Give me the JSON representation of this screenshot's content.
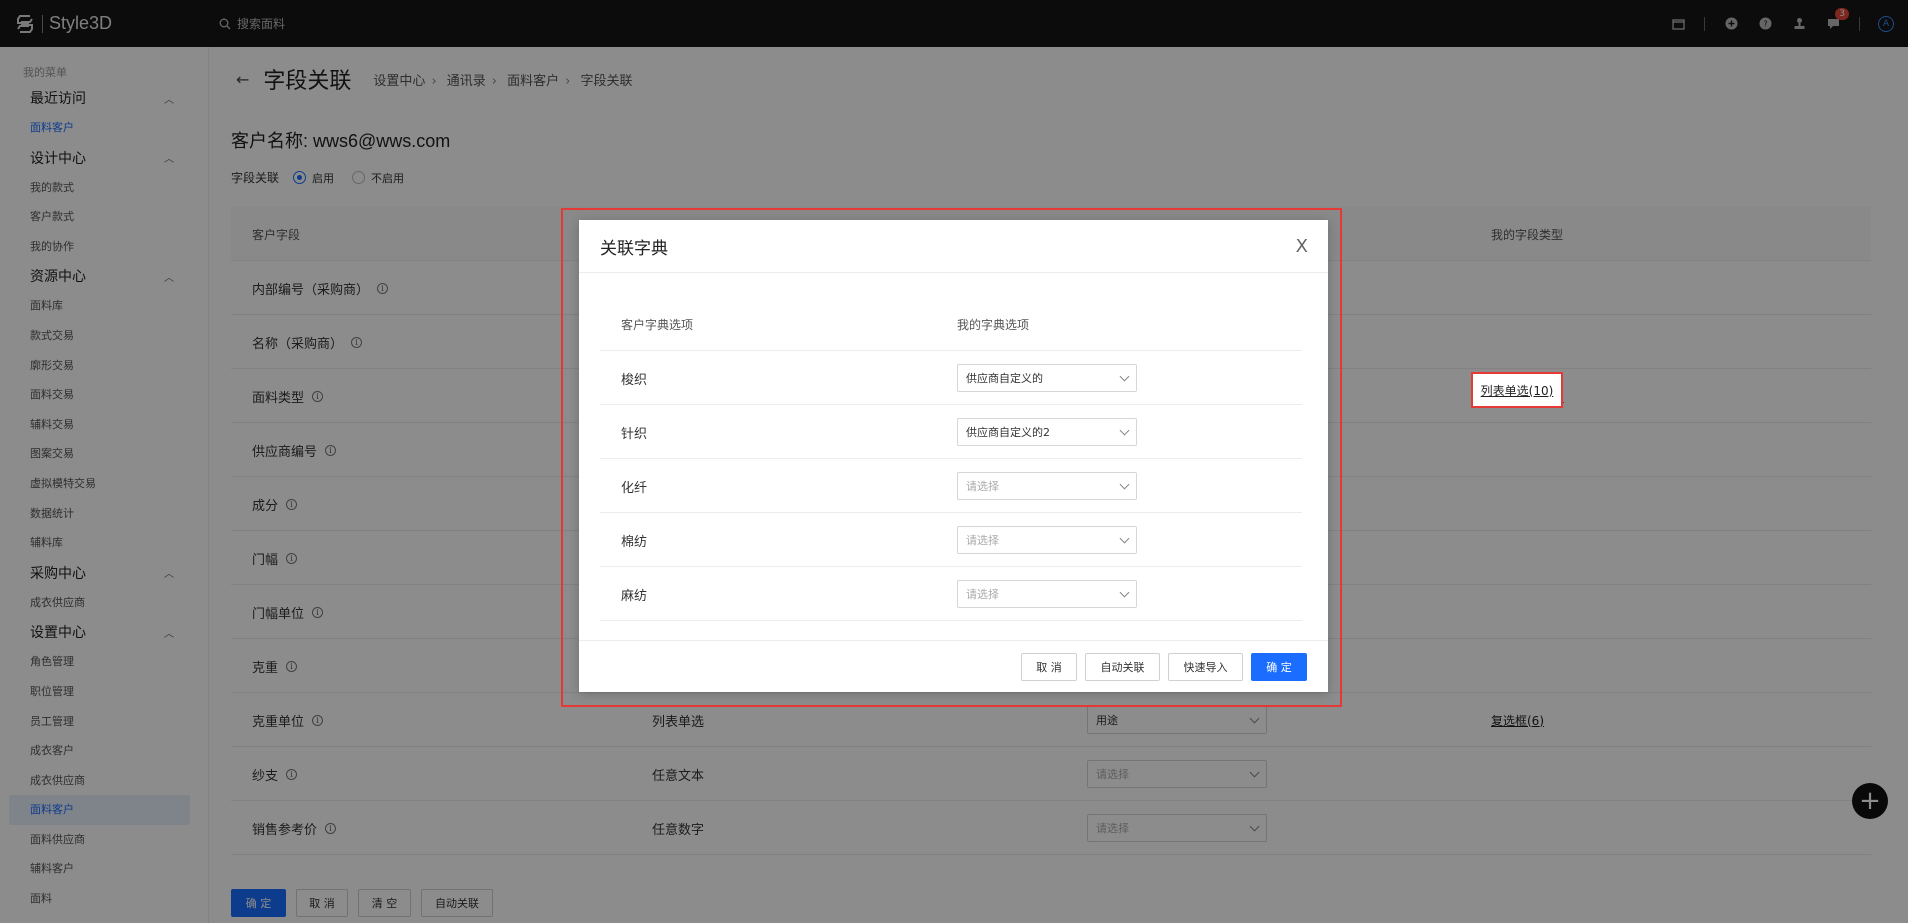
{
  "app": {
    "name": "Style3D",
    "search_placeholder": "搜索面料"
  },
  "topbar": {
    "notification_count": "3",
    "avatar_letter": "A"
  },
  "sidebar": {
    "caption": "我的菜单",
    "groups": [
      {
        "title": "最近访问",
        "items": [
          "面料客户"
        ]
      },
      {
        "title": "设计中心",
        "items": [
          "我的款式",
          "客户款式",
          "我的协作"
        ]
      },
      {
        "title": "资源中心",
        "items": [
          "面料库",
          "款式交易",
          "廓形交易",
          "面料交易",
          "辅料交易",
          "图案交易",
          "虚拟模特交易",
          "数据统计",
          "辅料库"
        ]
      },
      {
        "title": "采购中心",
        "items": [
          "成衣供应商"
        ]
      },
      {
        "title": "设置中心",
        "items": [
          "角色管理",
          "职位管理",
          "员工管理",
          "成衣客户",
          "成衣供应商",
          "面料客户",
          "面料供应商",
          "辅料客户",
          "面料"
        ]
      }
    ]
  },
  "page": {
    "title": "字段关联",
    "breadcrumb": [
      "设置中心",
      "通讯录",
      "面料客户",
      "字段关联"
    ],
    "customer_label": "客户名称: wws6@wws.com",
    "toggle_label": "字段关联",
    "toggle_on": "启用",
    "toggle_off": "不启用",
    "table_headers": [
      "客户字段",
      "我的字段类型"
    ],
    "rows": [
      {
        "field": "内部编号（采购商）",
        "type": "",
        "select": "",
        "my_type": ""
      },
      {
        "field": "名称（采购商）",
        "type": "",
        "select": "",
        "my_type": ""
      },
      {
        "field": "面料类型",
        "type": "",
        "select": "",
        "my_type": "列表单选(10)"
      },
      {
        "field": "供应商编号",
        "type": "",
        "select": "",
        "my_type": ""
      },
      {
        "field": "成分",
        "type": "",
        "select": "",
        "my_type": ""
      },
      {
        "field": "门幅",
        "type": "",
        "select": "",
        "my_type": ""
      },
      {
        "field": "门幅单位",
        "type": "",
        "select": "",
        "my_type": ""
      },
      {
        "field": "克重",
        "type": "",
        "select": "",
        "my_type": ""
      },
      {
        "field": "克重单位",
        "type": "列表单选",
        "select": "用途",
        "my_type": "复选框(6)"
      },
      {
        "field": "纱支",
        "type": "任意文本",
        "select": "请选择",
        "my_type": ""
      },
      {
        "field": "销售参考价",
        "type": "任意数字",
        "select": "请选择",
        "my_type": ""
      }
    ],
    "buttons": {
      "confirm": "确 定",
      "cancel": "取 消",
      "clear": "清 空",
      "auto": "自动关联"
    }
  },
  "modal": {
    "title": "关联字典",
    "close": "X",
    "col_customer": "客户字典选项",
    "col_mine": "我的字典选项",
    "rows": [
      {
        "option": "梭织",
        "value": "供应商自定义的",
        "placeholder": false
      },
      {
        "option": "针织",
        "value": "供应商自定义的2",
        "placeholder": false
      },
      {
        "option": "化纤",
        "value": "请选择",
        "placeholder": true
      },
      {
        "option": "棉纺",
        "value": "请选择",
        "placeholder": true
      },
      {
        "option": "麻纺",
        "value": "请选择",
        "placeholder": true
      }
    ],
    "buttons": {
      "cancel": "取 消",
      "auto": "自动关联",
      "import": "快速导入",
      "confirm": "确 定"
    }
  },
  "colors": {
    "accent": "#1a6dff",
    "highlight": "#e53935",
    "topbar": "#161616"
  }
}
